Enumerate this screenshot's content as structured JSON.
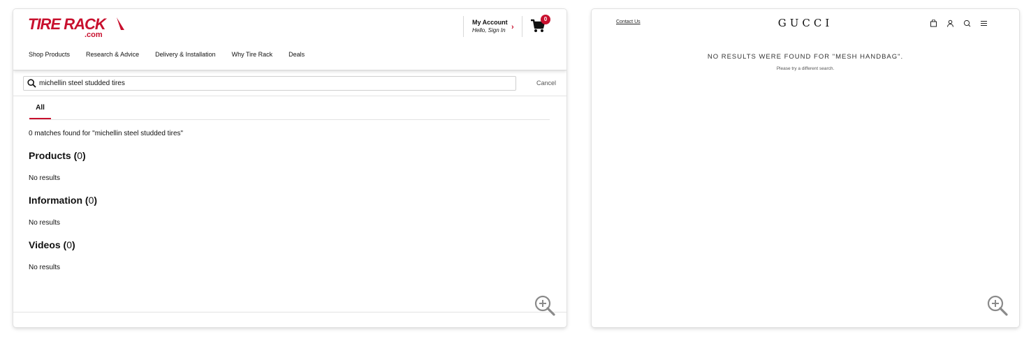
{
  "tirerack": {
    "logo_text": "TIRE RACK",
    "logo_sub": ".com",
    "account_title": "My Account",
    "account_sub": "Hello, Sign In",
    "cart_count": "0",
    "nav": [
      "Shop Products",
      "Research & Advice",
      "Delivery & Installation",
      "Why Tire Rack",
      "Deals"
    ],
    "search_value": "michellin steel studded tires",
    "cancel_label": "Cancel",
    "tab_all": "All",
    "summary": "0 matches found for \"michellin steel studded tires\"",
    "sections": [
      {
        "title": "Products",
        "count": "0",
        "empty": "No results"
      },
      {
        "title": "Information",
        "count": "0",
        "empty": "No results"
      },
      {
        "title": "Videos",
        "count": "0",
        "empty": "No results"
      }
    ],
    "brand_color": "#c8102e"
  },
  "gucci": {
    "contact": "Contact Us",
    "logo": "GUCCI",
    "message": "NO RESULTS WERE FOUND FOR \"MESH HANDBAG\".",
    "sub": "Please try a different search.",
    "icons": [
      "bag-icon",
      "account-icon",
      "search-icon",
      "menu-icon"
    ]
  }
}
